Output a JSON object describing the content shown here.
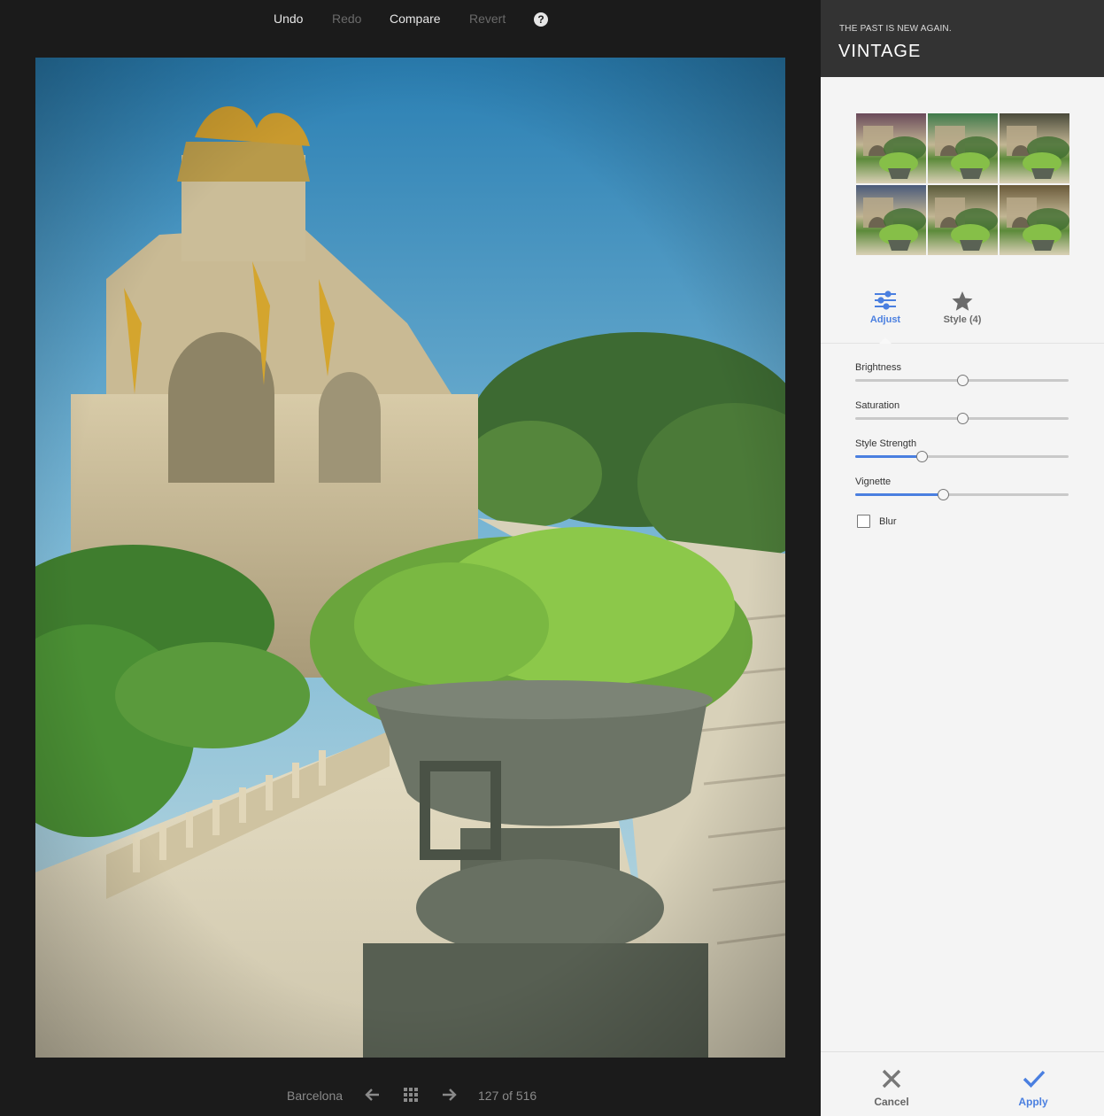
{
  "toolbar": {
    "undo": "Undo",
    "redo": "Redo",
    "compare": "Compare",
    "revert": "Revert",
    "help": "?"
  },
  "bottom_nav": {
    "album": "Barcelona",
    "counter": "127 of 516"
  },
  "panel": {
    "subtitle": "THE PAST IS NEW AGAIN.",
    "title": "VINTAGE",
    "tabs": [
      {
        "label": "Adjust",
        "icon": "sliders-icon",
        "active": true
      },
      {
        "label": "Style (4)",
        "icon": "star-icon",
        "active": false
      }
    ],
    "sliders": [
      {
        "label": "Brightness",
        "value": 0.5,
        "fill": false
      },
      {
        "label": "Saturation",
        "value": 0.5,
        "fill": false
      },
      {
        "label": "Style Strength",
        "value": 0.31,
        "fill": true
      },
      {
        "label": "Vignette",
        "value": 0.41,
        "fill": true
      }
    ],
    "blur": {
      "label": "Blur",
      "checked": false
    },
    "cancel": "Cancel",
    "apply": "Apply"
  },
  "colors": {
    "accent": "#4a7fe0",
    "header_bg": "#333333",
    "panel_bg": "#f4f4f4",
    "app_bg": "#1b1b1b"
  },
  "thumbnails": [
    {
      "tint": "#6a4a5a"
    },
    {
      "tint": "#3f7a4a"
    },
    {
      "tint": "#4a4a3a"
    },
    {
      "tint": "#4a5a7a"
    },
    {
      "tint": "#5a5a3a"
    },
    {
      "tint": "#6a5a3a"
    }
  ]
}
